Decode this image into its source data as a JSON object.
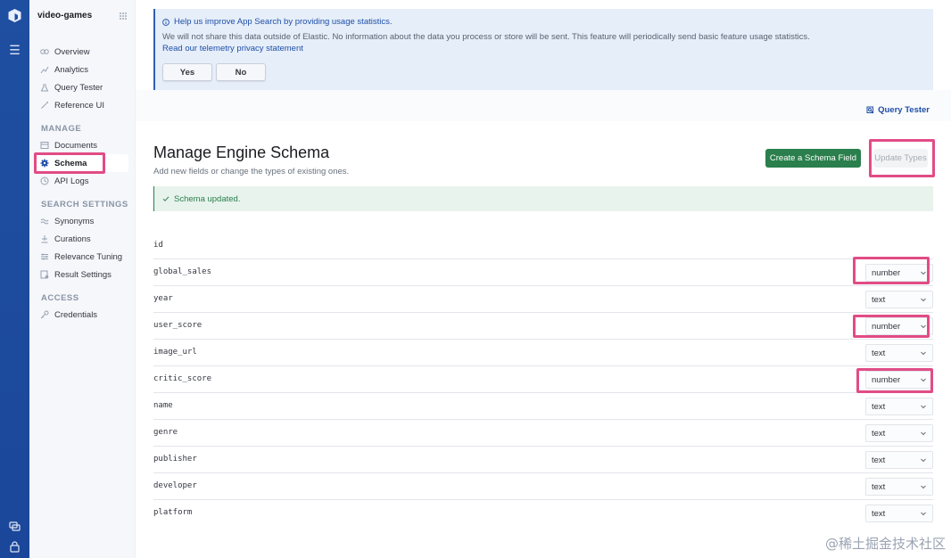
{
  "sidebar": {
    "engine_name": "video-games",
    "items": [
      {
        "label": "Overview",
        "icon": "overview-icon"
      },
      {
        "label": "Analytics",
        "icon": "analytics-icon"
      },
      {
        "label": "Query Tester",
        "icon": "flask-icon"
      },
      {
        "label": "Reference UI",
        "icon": "wand-icon"
      }
    ],
    "manage_heading": "MANAGE",
    "manage_items": [
      {
        "label": "Documents",
        "icon": "documents-icon"
      },
      {
        "label": "Schema",
        "icon": "gear-icon",
        "active": true
      },
      {
        "label": "API Logs",
        "icon": "clock-icon"
      }
    ],
    "search_heading": "SEARCH SETTINGS",
    "search_items": [
      {
        "label": "Synonyms",
        "icon": "synonyms-icon"
      },
      {
        "label": "Curations",
        "icon": "curations-icon"
      },
      {
        "label": "Relevance Tuning",
        "icon": "sliders-icon"
      },
      {
        "label": "Result Settings",
        "icon": "result-settings-icon"
      }
    ],
    "access_heading": "ACCESS",
    "access_items": [
      {
        "label": "Credentials",
        "icon": "key-icon"
      }
    ]
  },
  "telemetry": {
    "title": "Help us improve App Search by providing usage statistics.",
    "description": "We will not share this data outside of Elastic. No information about the data you process or store will be sent. This feature will periodically send basic feature usage statistics.",
    "link": "Read our telemetry privacy statement",
    "yes_label": "Yes",
    "no_label": "No"
  },
  "header": {
    "query_tester_link": "Query Tester"
  },
  "page": {
    "title": "Manage Engine Schema",
    "subtitle": "Add new fields or change the types of existing ones.",
    "create_button": "Create a Schema Field",
    "update_button": "Update Types",
    "success_message": "Schema updated."
  },
  "schema": {
    "id_field": "id",
    "fields": [
      {
        "name": "global_sales",
        "type": "number"
      },
      {
        "name": "year",
        "type": "text"
      },
      {
        "name": "user_score",
        "type": "number"
      },
      {
        "name": "image_url",
        "type": "text"
      },
      {
        "name": "critic_score",
        "type": "number"
      },
      {
        "name": "name",
        "type": "text"
      },
      {
        "name": "genre",
        "type": "text"
      },
      {
        "name": "publisher",
        "type": "text"
      },
      {
        "name": "developer",
        "type": "text"
      },
      {
        "name": "platform",
        "type": "text"
      }
    ]
  },
  "watermark": "@稀土掘金技术社区",
  "colors": {
    "highlight": "#e14c86",
    "primary_blue": "#1e4fa8",
    "success_green": "#2a7f4c"
  }
}
